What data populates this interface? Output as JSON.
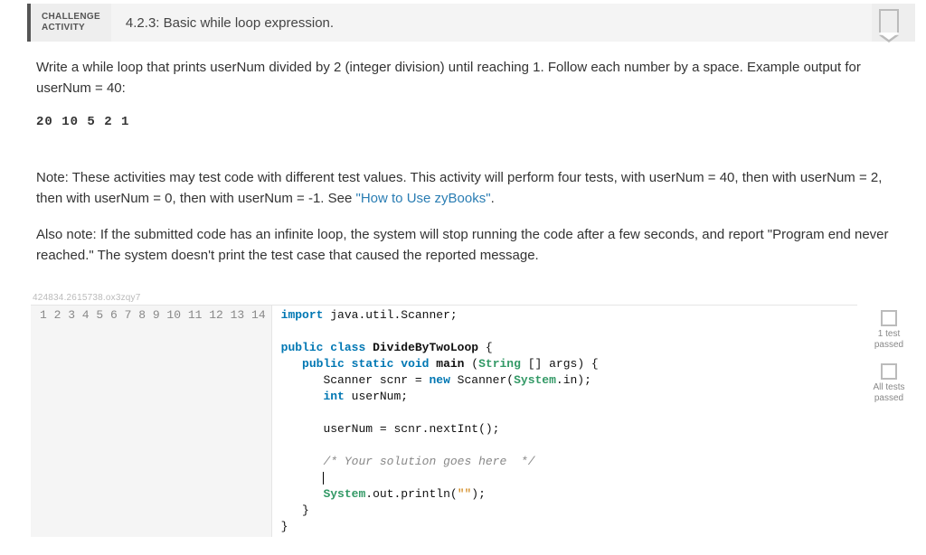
{
  "header": {
    "tag_line1": "CHALLENGE",
    "tag_line2": "ACTIVITY",
    "title": "4.2.3: Basic while loop expression."
  },
  "prompt": {
    "p1": "Write a while loop that prints userNum divided by 2 (integer division) until reaching 1. Follow each number by a space. Example output for userNum = 40:",
    "example_output": "20 10 5 2 1",
    "note1a": "Note: These activities may test code with different test values. This activity will perform four tests, with userNum = 40, then with userNum = 2, then with userNum = 0, then with userNum = -1. See ",
    "note1_link": "\"How to Use zyBooks\"",
    "note1b": ".",
    "note2": "Also note: If the submitted code has an infinite loop, the system will stop running the code after a few seconds, and report \"Program end never reached.\" The system doesn't print the test case that caused the reported message."
  },
  "watermark": "424834.2615738.ox3zqy7",
  "code": {
    "line_count": 14,
    "lines": {
      "l1_import": "import",
      "l1_rest": " java.util.Scanner;",
      "l3_a": "public class",
      "l3_b": " DivideByTwoLoop",
      "l3_c": " {",
      "l4_a": "   public static void",
      "l4_b": " main",
      "l4_c": " (",
      "l4_d": "String",
      "l4_e": " [] args) {",
      "l5_a": "      Scanner scnr = ",
      "l5_b": "new",
      "l5_c": " Scanner(",
      "l5_d": "System",
      "l5_e": ".in);",
      "l6_a": "      int",
      "l6_b": " userNum;",
      "l8": "      userNum = scnr.nextInt();",
      "l10_a": "      ",
      "l10_b": "/* Your solution goes here  */",
      "l11": "      ",
      "l12_a": "      ",
      "l12_b": "System",
      "l12_c": ".out.println(",
      "l12_d": "\"\"",
      "l12_e": ");",
      "l13": "   }",
      "l14": "}"
    }
  },
  "status": {
    "test1": "1 test\npassed",
    "test_all": "All tests\npassed"
  }
}
